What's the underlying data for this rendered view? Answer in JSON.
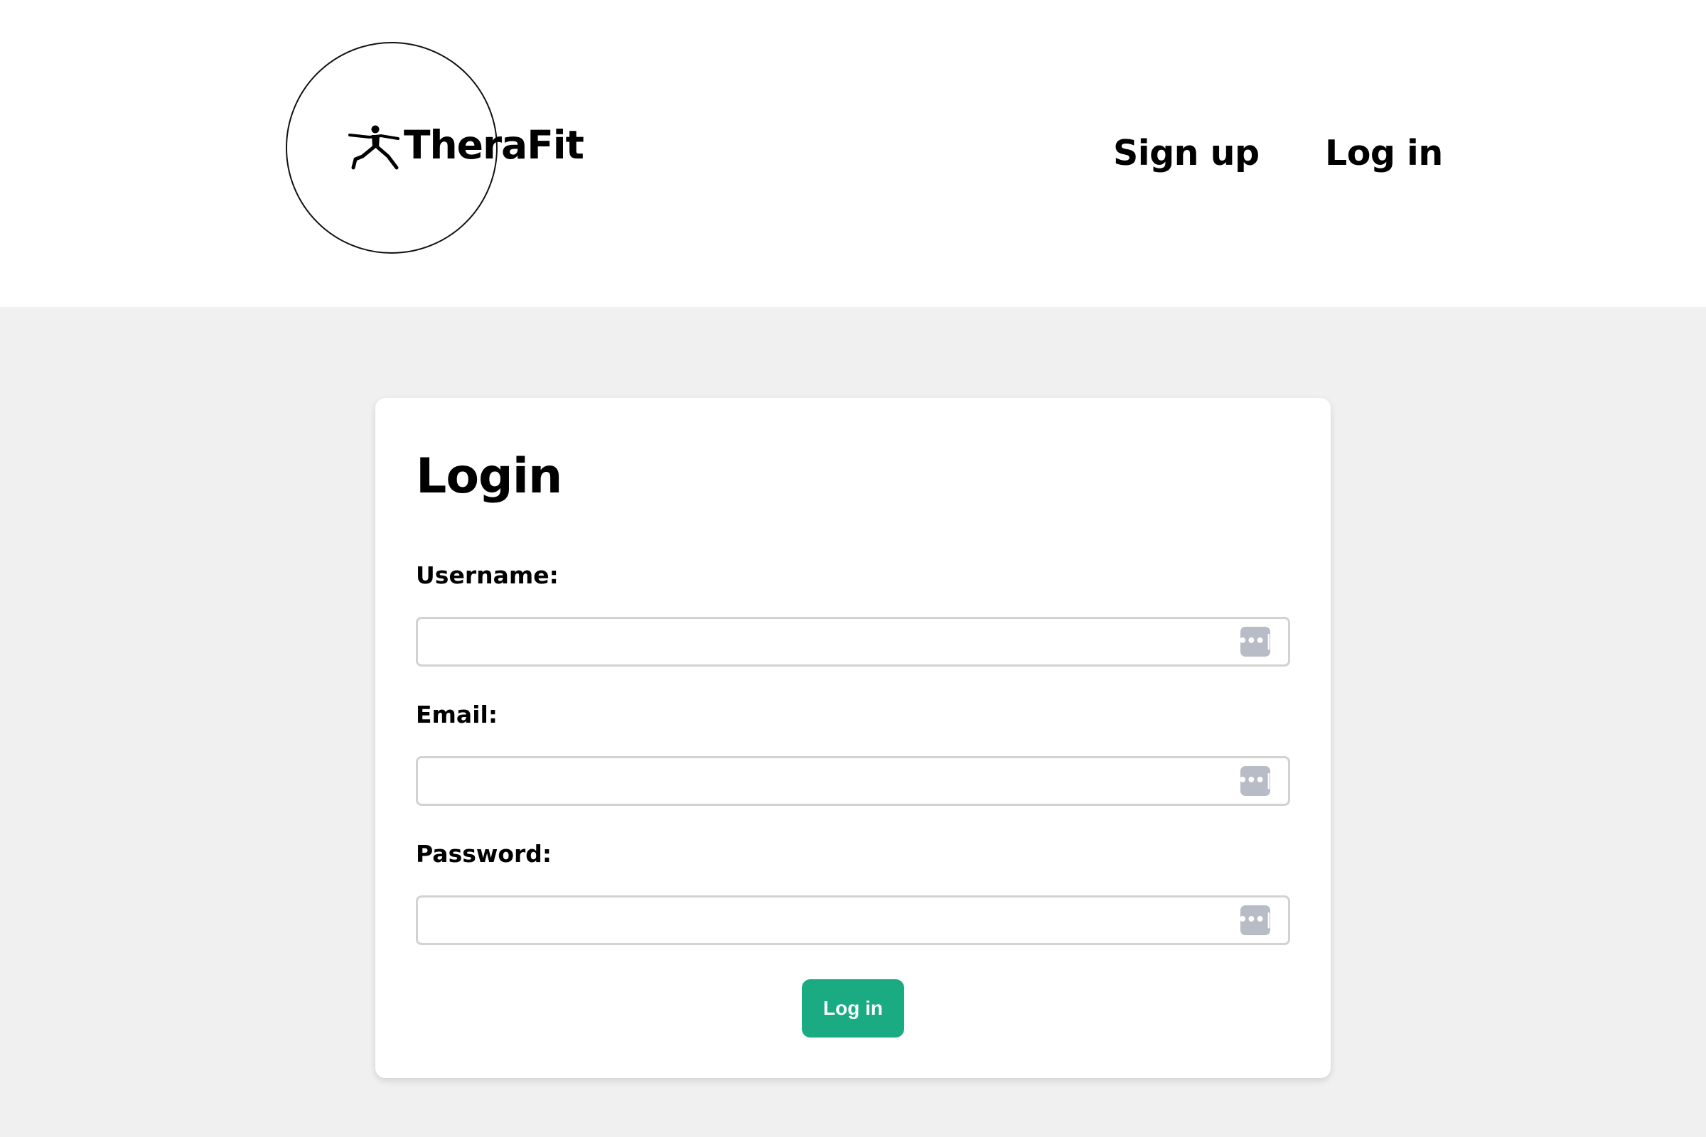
{
  "header": {
    "brand": "TheraFit",
    "nav": {
      "signup": "Sign up",
      "login": "Log in"
    }
  },
  "login_card": {
    "title": "Login",
    "fields": [
      {
        "label": "Username:",
        "value": "",
        "placeholder": ""
      },
      {
        "label": "Email:",
        "value": "",
        "placeholder": ""
      },
      {
        "label": "Password:",
        "value": "",
        "placeholder": ""
      }
    ],
    "autofill_icon_glyph": "•••|",
    "submit_label": "Log in"
  },
  "colors": {
    "page_background": "#f0f0f0",
    "header_background": "#ffffff",
    "accent_button": "#1aab82",
    "autofill_icon": "#b8bcc6"
  },
  "icons": {
    "logo": "yoga-warrior-figure-icon",
    "autofill": "password-manager-key-icon"
  }
}
